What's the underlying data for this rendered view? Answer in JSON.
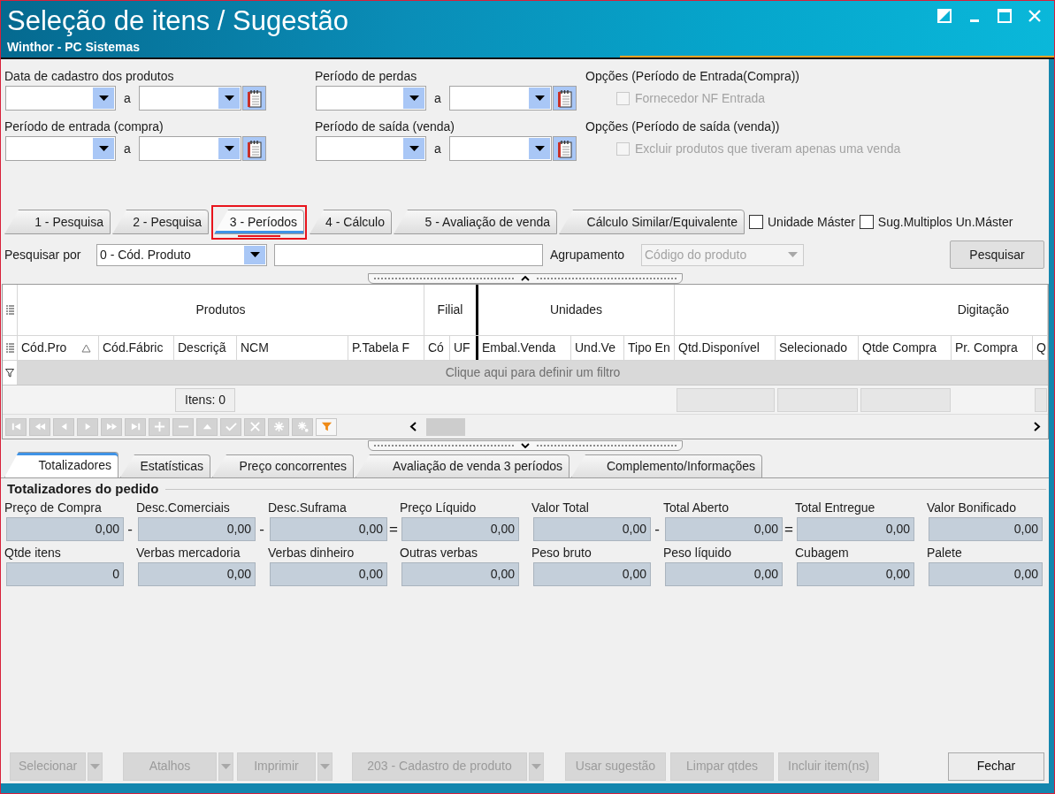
{
  "window": {
    "title": "Seleção de itens / Sugestão",
    "subtitle": "Winthor - PC Sistemas"
  },
  "date_ranges": [
    {
      "label": "Data de cadastro dos produtos",
      "separator": "a"
    },
    {
      "label": "Período de perdas",
      "separator": "a"
    },
    {
      "label": "Período de entrada (compra)",
      "separator": "a"
    },
    {
      "label": "Período de saída (venda)",
      "separator": "a"
    }
  ],
  "option_groups": [
    {
      "title": "Opções (Período de Entrada(Compra))",
      "checkbox": {
        "label": "Fornecedor NF Entrada",
        "checked": false,
        "disabled": true
      }
    },
    {
      "title": "Opções (Período de saída (venda))",
      "checkbox": {
        "label": "Excluir produtos que tiveram apenas uma venda",
        "checked": false,
        "disabled": true
      }
    }
  ],
  "tabs": [
    {
      "label": "1 - Pesquisa",
      "selected": false,
      "highlighted": false
    },
    {
      "label": "2 - Pesquisa",
      "selected": false,
      "highlighted": false
    },
    {
      "label": "3 - Períodos",
      "selected": true,
      "highlighted": true
    },
    {
      "label": "4 - Cálculo",
      "selected": false,
      "highlighted": false
    },
    {
      "label": "5 - Avaliação de venda",
      "selected": false,
      "highlighted": false
    },
    {
      "label": "Cálculo Similar/Equivalente",
      "selected": false,
      "highlighted": false
    }
  ],
  "tab_options": [
    {
      "label": "Unidade Máster",
      "checked": false
    },
    {
      "label": "Sug.Multiplos Un.Máster",
      "checked": false
    }
  ],
  "search": {
    "label": "Pesquisar por",
    "type_value": "0 - Cód. Produto",
    "grouping_label": "Agrupamento",
    "grouping_value": "Código do produto",
    "grouping_disabled": true,
    "button": "Pesquisar"
  },
  "grid": {
    "bands": [
      {
        "label": "Produtos",
        "columns": [
          {
            "label": "Cód.Pro",
            "sorted": true
          },
          {
            "label": "Cód.Fábric",
            "sorted": false
          },
          {
            "label": "Descriçã",
            "sorted": false
          },
          {
            "label": "NCM",
            "sorted": false
          },
          {
            "label": "P.Tabela F",
            "sorted": false
          }
        ]
      },
      {
        "label": "Filial",
        "columns": [
          {
            "label": "Có",
            "sorted": false
          },
          {
            "label": "UF",
            "sorted": false
          }
        ]
      },
      {
        "label": "Unidades",
        "columns": [
          {
            "label": "Embal.Venda",
            "sorted": false
          },
          {
            "label": "Und.Ve",
            "sorted": false
          },
          {
            "label": "Tipo En",
            "sorted": false
          }
        ]
      },
      {
        "label": "Digitação",
        "columns": [
          {
            "label": "Qtd.Disponível",
            "sorted": false
          },
          {
            "label": "Selecionado",
            "sorted": false
          },
          {
            "label": "Qtde Compra",
            "sorted": false
          },
          {
            "label": "Pr. Compra",
            "sorted": false
          },
          {
            "label": "Q",
            "sorted": false
          }
        ]
      }
    ],
    "filter_prompt": "Clique aqui para definir um filtro",
    "item_count": "Itens: 0"
  },
  "navigator": [
    {
      "kind": "first",
      "disabled": true
    },
    {
      "kind": "prior_page",
      "disabled": true
    },
    {
      "kind": "prior",
      "disabled": true
    },
    {
      "kind": "next",
      "disabled": true
    },
    {
      "kind": "next_page",
      "disabled": true
    },
    {
      "kind": "last",
      "disabled": true
    },
    {
      "kind": "insert",
      "disabled": true
    },
    {
      "kind": "delete",
      "disabled": true
    },
    {
      "kind": "edit",
      "disabled": true
    },
    {
      "kind": "post",
      "disabled": true
    },
    {
      "kind": "cancel",
      "disabled": true
    },
    {
      "kind": "refresh",
      "disabled": true
    },
    {
      "kind": "bookmark",
      "disabled": true
    },
    {
      "kind": "filter",
      "disabled": false
    }
  ],
  "bottom_tabs": [
    {
      "label": "Totalizadores",
      "selected": true
    },
    {
      "label": "Estatísticas",
      "selected": false
    },
    {
      "label": "Preço concorrentes",
      "selected": false
    },
    {
      "label": "Avaliação de venda 3 períodos",
      "selected": false
    },
    {
      "label": "Complemento/Informações",
      "selected": false
    }
  ],
  "totals": {
    "title": "Totalizadores do pedido",
    "rows": [
      [
        {
          "label": "Preço de Compra",
          "value": "0,00",
          "operator": "-"
        },
        {
          "label": "Desc.Comerciais",
          "value": "0,00",
          "operator": "-"
        },
        {
          "label": "Desc.Suframa",
          "value": "0,00",
          "operator": "="
        },
        {
          "label": "Preço Líquido",
          "value": "0,00"
        },
        {
          "label": "Valor Total",
          "value": "0,00",
          "operator": "-"
        },
        {
          "label": "Total Aberto",
          "value": "0,00",
          "operator": "="
        },
        {
          "label": "Total Entregue",
          "value": "0,00"
        },
        {
          "label": "Valor Bonificado",
          "value": "0,00"
        }
      ],
      [
        {
          "label": "Qtde itens",
          "value": "0"
        },
        {
          "label": "Verbas mercadoria",
          "value": "0,00"
        },
        {
          "label": "Verbas dinheiro",
          "value": "0,00"
        },
        {
          "label": "Outras verbas",
          "value": "0,00"
        },
        {
          "label": "Peso bruto",
          "value": "0,00"
        },
        {
          "label": "Peso líquido",
          "value": "0,00"
        },
        {
          "label": "Cubagem",
          "value": "0,00"
        },
        {
          "label": "Palete",
          "value": "0,00"
        }
      ]
    ]
  },
  "footer_buttons": [
    {
      "label": "Selecionar",
      "disabled": true,
      "dropdown": true
    },
    {
      "label": "Atalhos",
      "disabled": true,
      "dropdown": true
    },
    {
      "label": "Imprimir",
      "disabled": true,
      "dropdown": true
    },
    {
      "label": "203 - Cadastro de produto",
      "disabled": true,
      "dropdown": true
    },
    {
      "label": "Usar sugestão",
      "disabled": true,
      "dropdown": false
    },
    {
      "label": "Limpar qtdes",
      "disabled": true,
      "dropdown": false
    },
    {
      "label": "Incluir item(ns)",
      "disabled": true,
      "dropdown": false
    },
    {
      "label": "Fechar",
      "disabled": false,
      "dropdown": false
    }
  ]
}
